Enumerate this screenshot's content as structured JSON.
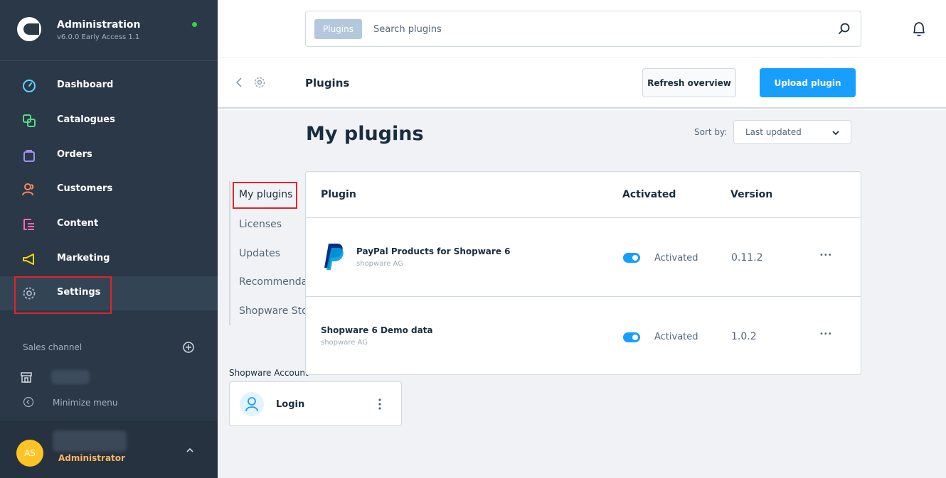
{
  "sidebar": {
    "brand": {
      "title": "Administration",
      "version": "v6.0.0 Early Access 1.1"
    },
    "items": [
      {
        "label": "Dashboard",
        "icon": "dashboard-icon"
      },
      {
        "label": "Catalogues",
        "icon": "catalogue-icon"
      },
      {
        "label": "Orders",
        "icon": "orders-bag-icon"
      },
      {
        "label": "Customers",
        "icon": "customers-icon"
      },
      {
        "label": "Content",
        "icon": "content-icon"
      },
      {
        "label": "Marketing",
        "icon": "megaphone-icon"
      },
      {
        "label": "Settings",
        "icon": "gear-icon"
      }
    ],
    "sales_channel_label": "Sales channel",
    "minimize_label": "Minimize menu",
    "profile": {
      "initials": "AS",
      "role": "Administrator"
    }
  },
  "topbar": {
    "search_chip": "Plugins",
    "search_placeholder": "Search plugins"
  },
  "header": {
    "title": "Plugins",
    "refresh_label": "Refresh overview",
    "upload_label": "Upload plugin"
  },
  "main": {
    "section_title": "My plugins",
    "sort_label": "Sort by:",
    "sort_value": "Last updated",
    "tabs": [
      {
        "label": "My plugins"
      },
      {
        "label": "Licenses"
      },
      {
        "label": "Updates"
      },
      {
        "label": "Recommendations"
      },
      {
        "label": "Shopware Store"
      }
    ],
    "account_label": "Shopware Account",
    "login_label": "Login",
    "table": {
      "columns": [
        "Plugin",
        "Activated",
        "Version"
      ],
      "rows": [
        {
          "name": "PayPal Products for Shopware 6",
          "vendor": "shopware AG",
          "status": "Activated",
          "version": "0.11.2",
          "actions": "•••"
        },
        {
          "name": "Shopware 6 Demo data",
          "vendor": "shopware AG",
          "status": "Activated",
          "version": "1.0.2",
          "actions": "•••"
        }
      ]
    }
  },
  "colors": {
    "sidebar_bg": "#2b3847",
    "accent": "#189eff",
    "highlight": "#e0242a",
    "status_online": "#37d046"
  }
}
